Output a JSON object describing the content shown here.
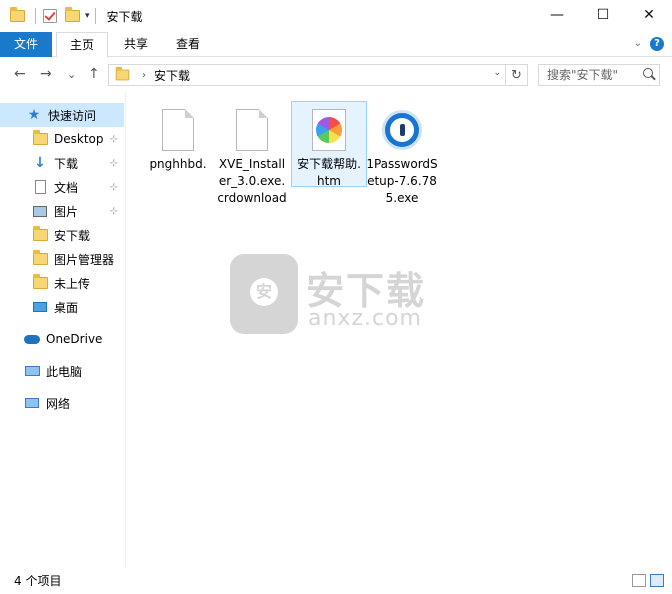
{
  "window": {
    "title": "安下载",
    "controls": {
      "minimize": "—",
      "maximize": "☐",
      "close": "✕"
    }
  },
  "quick_access_toolbar": {
    "dropdown": "▾"
  },
  "ribbon": {
    "tabs": [
      "文件",
      "主页",
      "共享",
      "查看"
    ],
    "expand_caret": "⌄",
    "help": "?"
  },
  "address_bar": {
    "back": "←",
    "forward": "→",
    "recent": "⌄",
    "up": "↑",
    "separator": "›",
    "path": "安下载",
    "dropdown": "⌄",
    "refresh": "↻"
  },
  "search": {
    "placeholder": "搜索\"安下载\""
  },
  "sidebar": {
    "quick_access": "快速访问",
    "items": [
      {
        "label": "Desktop",
        "icon": "folder-icon",
        "pinned": true
      },
      {
        "label": "下载",
        "icon": "download-icon",
        "pinned": true
      },
      {
        "label": "文档",
        "icon": "document-icon",
        "pinned": true
      },
      {
        "label": "图片",
        "icon": "pictures-icon",
        "pinned": true
      },
      {
        "label": "安下载",
        "icon": "folder-icon",
        "pinned": false
      },
      {
        "label": "图片管理器",
        "icon": "folder-icon",
        "pinned": false
      },
      {
        "label": "未上传",
        "icon": "folder-icon",
        "pinned": false
      },
      {
        "label": "桌面",
        "icon": "desktop-icon",
        "pinned": false
      }
    ],
    "pin_glyph": "📌",
    "onedrive": "OneDrive",
    "this_pc": "此电脑",
    "network": "网络"
  },
  "files": [
    {
      "name": "pnghhbd.",
      "icon": "blank-file-icon",
      "selected": false
    },
    {
      "name": "XVE_Installer_3.0.exe.crdownload",
      "icon": "blank-file-icon",
      "selected": false
    },
    {
      "name": "安下载帮助.htm",
      "icon": "photos-file-icon",
      "selected": true
    },
    {
      "name": "1PasswordSetup-7.6.785.exe",
      "icon": "1password-icon",
      "selected": false
    }
  ],
  "watermark": {
    "shield_label": "安",
    "text": "安下载",
    "domain": "anxz.com"
  },
  "status": {
    "count": "4 个项目"
  },
  "colors": {
    "file_tab": "#1979ca",
    "selection": "#cce8ff",
    "selected_item_border": "#99d1ff"
  }
}
